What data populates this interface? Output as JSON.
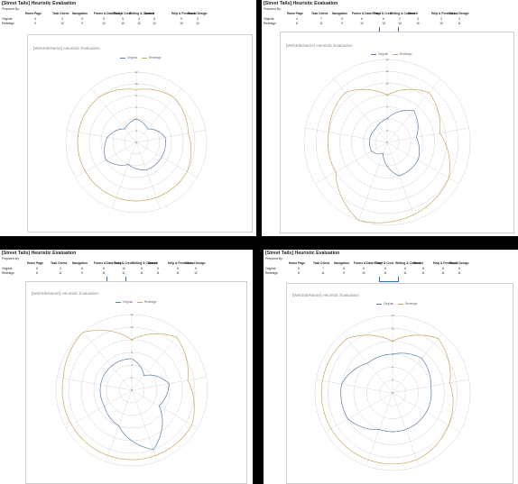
{
  "colors": {
    "original": "#5b7fa6",
    "redesign": "#c9a662",
    "grid": "#d4d4d4",
    "spoke": "#d9d9d9"
  },
  "panels": [
    {
      "title": "[Street Tails] Heuristic Evaluation",
      "prepared_by": "Prepared By:",
      "headers": [
        "Home Page",
        "Task Orient.",
        "Navigation",
        "Forms & Data Entry",
        "Trust & Cred.",
        "Writing & Content",
        "Search",
        "Help & Feedback",
        "Visual Design"
      ],
      "rows": [
        {
          "label": "Original",
          "values": [
            "4",
            "3",
            "5",
            "5",
            "5",
            "4",
            "6",
            "5",
            "3"
          ]
        },
        {
          "label": "Redesign",
          "values": [
            "9",
            "10",
            "9",
            "10",
            "10",
            "10",
            "10",
            "10",
            "10"
          ]
        }
      ],
      "chart_title": "[WebSiteName] Heuristic Evaluation",
      "legend": [
        "Original",
        "Redesign"
      ],
      "ticks": [
        "0",
        "2",
        "4",
        "6",
        "8",
        "10",
        "12"
      ]
    },
    {
      "title": "[Street Tails] Heuristic Evaluation",
      "prepared_by": "Prepared By:",
      "headers": [
        "Home Page",
        "Task Orient.",
        "Navigation",
        "Forms & Data Entry",
        "Trust & Cred.",
        "Writing & Content",
        "Search",
        "Help & Feedback",
        "Visual Design"
      ],
      "rows": [
        {
          "label": "Original",
          "values": [
            "4",
            "7",
            "5",
            "6",
            "6",
            "2",
            "3",
            "3",
            "3"
          ]
        },
        {
          "label": "Redesign",
          "values": [
            "8",
            "11",
            "9",
            "12",
            "13",
            "14",
            "10",
            "10",
            "11"
          ]
        }
      ],
      "chart_title": "[WebSiteName] Heuristic Evaluation",
      "legend": [
        "Original",
        "Redesign"
      ],
      "ticks": [
        "0",
        "2",
        "4",
        "6",
        "8",
        "10",
        "12",
        "14"
      ]
    },
    {
      "title": "[Street Tails] Heuristic Evaluation",
      "prepared_by": "Prepared By:",
      "headers": [
        "Home Page",
        "Task Orient.",
        "Navigation",
        "Forms & Data Entry",
        "Trust & Cred.",
        "Writing & Content",
        "Search",
        "Help & Feedback",
        "Visual Design"
      ],
      "rows": [
        {
          "label": "Original",
          "values": [
            "5",
            "3",
            "6",
            "5",
            "10",
            "6",
            "5",
            "5",
            "5"
          ]
        },
        {
          "label": "Redesign",
          "values": [
            "8",
            "11",
            "9",
            "11",
            "11",
            "11",
            "11",
            "11",
            "12"
          ]
        }
      ],
      "chart_title": "[WebSiteName] Heuristic Evaluation",
      "legend": [
        "Original",
        "Redesign"
      ],
      "ticks": [
        "0",
        "2",
        "4",
        "6",
        "8",
        "10",
        "12"
      ]
    },
    {
      "title": "[Street Tails] Heuristic Evaluation",
      "prepared_by": "Prepared By:",
      "headers": [
        "Home Page",
        "Task Orient.",
        "Navigation",
        "Forms & Data Entry",
        "Trust & Cred.",
        "Writing & Content",
        "Search",
        "Help & Feedback",
        "Visual Design"
      ],
      "rows": [
        {
          "label": "Original",
          "values": [
            "6",
            "7",
            "6",
            "6",
            "6",
            "6",
            "8",
            "8",
            "6"
          ]
        },
        {
          "label": "Redesign",
          "values": [
            "8",
            "11",
            "9",
            "10",
            "11",
            "11",
            "11",
            "11",
            "11"
          ]
        }
      ],
      "chart_title": "[WebSiteName] Heuristic Evaluation",
      "legend": [
        "Original",
        "Redesign"
      ],
      "ticks": [
        "0",
        "2",
        "4",
        "6",
        "8",
        "10",
        "12"
      ]
    }
  ],
  "chart_data": [
    {
      "type": "radar",
      "title": "[WebSiteName] Heuristic Evaluation",
      "categories": [
        "Home Page",
        "Task Orient.",
        "Navigation",
        "Forms & Data Entry",
        "Trust & Cred.",
        "Writing & Content",
        "Search",
        "Help & Feedback",
        "Visual Design"
      ],
      "rlim": [
        0,
        12
      ],
      "series": [
        {
          "name": "Original",
          "values": [
            4,
            3,
            5,
            5,
            5,
            4,
            6,
            5,
            3
          ]
        },
        {
          "name": "Redesign",
          "values": [
            9,
            10,
            9,
            10,
            10,
            10,
            10,
            10,
            10
          ]
        }
      ]
    },
    {
      "type": "radar",
      "title": "[WebSiteName] Heuristic Evaluation",
      "categories": [
        "Home Page",
        "Task Orient.",
        "Navigation",
        "Forms & Data Entry",
        "Trust & Cred.",
        "Writing & Content",
        "Search",
        "Help & Feedback",
        "Visual Design"
      ],
      "rlim": [
        0,
        14
      ],
      "series": [
        {
          "name": "Original",
          "values": [
            4,
            7,
            5,
            6,
            6,
            2,
            3,
            3,
            3
          ]
        },
        {
          "name": "Redesign",
          "values": [
            8,
            11,
            9,
            12,
            13,
            14,
            10,
            10,
            11
          ]
        }
      ]
    },
    {
      "type": "radar",
      "title": "[WebSiteName] Heuristic Evaluation",
      "categories": [
        "Home Page",
        "Task Orient.",
        "Navigation",
        "Forms & Data Entry",
        "Trust & Cred.",
        "Writing & Content",
        "Search",
        "Help & Feedback",
        "Visual Design"
      ],
      "rlim": [
        0,
        12
      ],
      "series": [
        {
          "name": "Original",
          "values": [
            5,
            3,
            6,
            5,
            10,
            6,
            5,
            5,
            5
          ]
        },
        {
          "name": "Redesign",
          "values": [
            8,
            11,
            9,
            11,
            11,
            11,
            11,
            11,
            12
          ]
        }
      ]
    },
    {
      "type": "radar",
      "title": "[WebSiteName] Heuristic Evaluation",
      "categories": [
        "Home Page",
        "Task Orient.",
        "Navigation",
        "Forms & Data Entry",
        "Trust & Cred.",
        "Writing & Content",
        "Search",
        "Help & Feedback",
        "Visual Design"
      ],
      "rlim": [
        0,
        12
      ],
      "series": [
        {
          "name": "Original",
          "values": [
            6,
            7,
            6,
            6,
            6,
            6,
            8,
            8,
            6
          ]
        },
        {
          "name": "Redesign",
          "values": [
            8,
            11,
            9,
            10,
            11,
            11,
            11,
            11,
            11
          ]
        }
      ]
    }
  ]
}
